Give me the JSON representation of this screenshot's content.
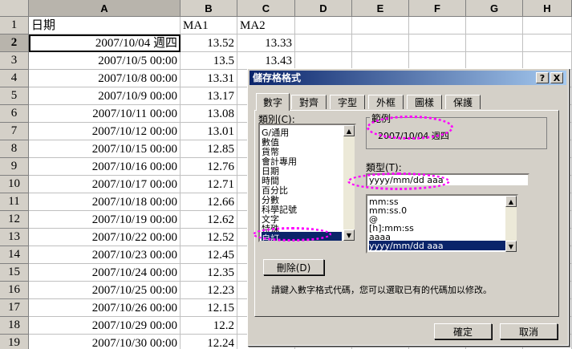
{
  "spreadsheet": {
    "columns": [
      "A",
      "B",
      "C",
      "D",
      "E",
      "F",
      "G",
      "H"
    ],
    "rows": [
      {
        "n": "1",
        "a": "日期",
        "b": "MA1",
        "c": "MA2"
      },
      {
        "n": "2",
        "a": "2007/10/04 週四",
        "b": "13.52",
        "c": "13.33"
      },
      {
        "n": "3",
        "a": "2007/10/5 00:00",
        "b": "13.5",
        "c": "13.43"
      },
      {
        "n": "4",
        "a": "2007/10/8 00:00",
        "b": "13.31",
        "c": ""
      },
      {
        "n": "5",
        "a": "2007/10/9 00:00",
        "b": "13.17",
        "c": ""
      },
      {
        "n": "6",
        "a": "2007/10/11 00:00",
        "b": "13.08",
        "c": ""
      },
      {
        "n": "7",
        "a": "2007/10/12 00:00",
        "b": "13.01",
        "c": ""
      },
      {
        "n": "8",
        "a": "2007/10/15 00:00",
        "b": "12.85",
        "c": ""
      },
      {
        "n": "9",
        "a": "2007/10/16 00:00",
        "b": "12.76",
        "c": ""
      },
      {
        "n": "10",
        "a": "2007/10/17 00:00",
        "b": "12.71",
        "c": ""
      },
      {
        "n": "11",
        "a": "2007/10/18 00:00",
        "b": "12.66",
        "c": ""
      },
      {
        "n": "12",
        "a": "2007/10/19 00:00",
        "b": "12.62",
        "c": ""
      },
      {
        "n": "13",
        "a": "2007/10/22 00:00",
        "b": "12.52",
        "c": ""
      },
      {
        "n": "14",
        "a": "2007/10/23 00:00",
        "b": "12.45",
        "c": ""
      },
      {
        "n": "15",
        "a": "2007/10/24 00:00",
        "b": "12.35",
        "c": ""
      },
      {
        "n": "16",
        "a": "2007/10/25 00:00",
        "b": "12.23",
        "c": ""
      },
      {
        "n": "17",
        "a": "2007/10/26 00:00",
        "b": "12.15",
        "c": ""
      },
      {
        "n": "18",
        "a": "2007/10/29 00:00",
        "b": "12.2",
        "c": ""
      },
      {
        "n": "19",
        "a": "2007/10/30 00:00",
        "b": "12.24",
        "c": ""
      }
    ]
  },
  "dialog": {
    "title": "儲存格格式",
    "help_label": "?",
    "close_label": "X",
    "tabs": [
      "數字",
      "對齊",
      "字型",
      "外框",
      "圖樣",
      "保護"
    ],
    "category_label": "類別(C):",
    "categories": [
      "G/通用",
      "數值",
      "貨幣",
      "會計專用",
      "日期",
      "時間",
      "百分比",
      "分數",
      "科學記號",
      "文字",
      "特殊",
      "自訂"
    ],
    "selected_category": "自訂",
    "sample_label": "範例",
    "sample_value": "2007/10/04 週四",
    "type_label": "類型(T):",
    "type_value": "yyyy/mm/dd aaa",
    "type_list": [
      "mm:ss",
      "mm:ss.0",
      "@",
      "[h]:mm:ss",
      "aaaa",
      "yyyy/mm/dd aaa"
    ],
    "selected_type": "yyyy/mm/dd aaa",
    "delete_label": "刪除(D)",
    "hint": "請鍵入數字格式代碼，您可以選取已有的代碼加以修改。",
    "ok_label": "確定",
    "cancel_label": "取消"
  }
}
